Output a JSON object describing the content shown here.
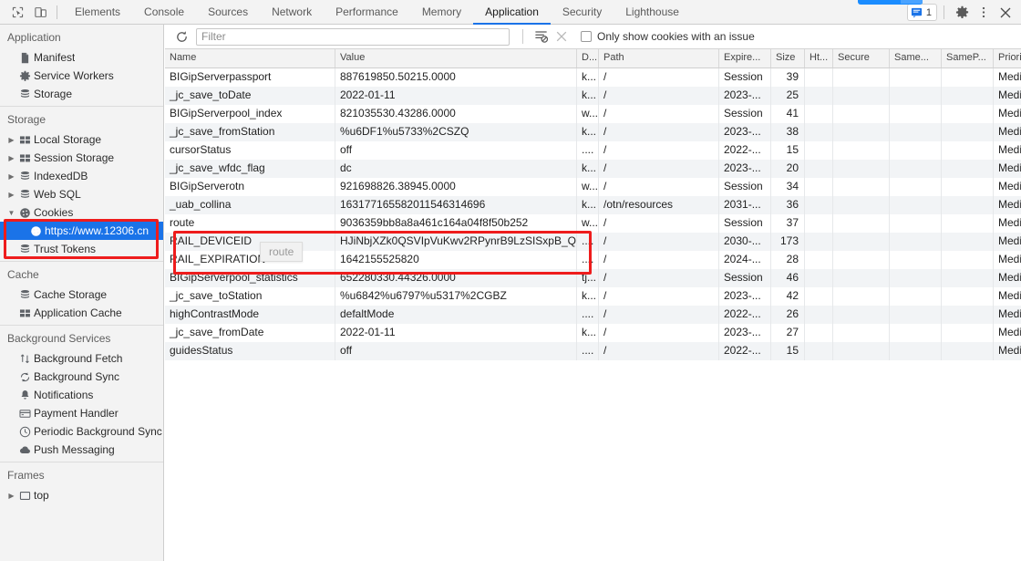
{
  "toolbar": {
    "inspect_icon": "inspect-element-icon",
    "device_icon": "device-toolbar-icon",
    "tabs": [
      {
        "label": "Elements",
        "active": false
      },
      {
        "label": "Console",
        "active": false
      },
      {
        "label": "Sources",
        "active": false
      },
      {
        "label": "Network",
        "active": false
      },
      {
        "label": "Performance",
        "active": false
      },
      {
        "label": "Memory",
        "active": false
      },
      {
        "label": "Application",
        "active": true
      },
      {
        "label": "Security",
        "active": false
      },
      {
        "label": "Lighthouse",
        "active": false
      }
    ],
    "message_count": "1",
    "settings_icon": "gear-icon",
    "more_icon": "more-vertical-icon",
    "close_icon": "close-icon"
  },
  "sidebar": {
    "sections": [
      {
        "title": "Application",
        "items": [
          {
            "label": "Manifest",
            "icon": "manifest-icon",
            "arrow": false,
            "sub": false,
            "selected": false
          },
          {
            "label": "Service Workers",
            "icon": "gear-icon",
            "arrow": false,
            "sub": false,
            "selected": false
          },
          {
            "label": "Storage",
            "icon": "database-icon",
            "arrow": false,
            "sub": false,
            "selected": false
          }
        ]
      },
      {
        "title": "Storage",
        "items": [
          {
            "label": "Local Storage",
            "icon": "table-icon",
            "arrow": true,
            "sub": false,
            "selected": false
          },
          {
            "label": "Session Storage",
            "icon": "table-icon",
            "arrow": true,
            "sub": false,
            "selected": false
          },
          {
            "label": "IndexedDB",
            "icon": "database-icon",
            "arrow": true,
            "sub": false,
            "selected": false
          },
          {
            "label": "Web SQL",
            "icon": "database-icon",
            "arrow": true,
            "sub": false,
            "selected": false
          },
          {
            "label": "Cookies",
            "icon": "cookie-icon",
            "arrow": "expanded",
            "sub": false,
            "selected": false
          },
          {
            "label": "https://www.12306.cn",
            "icon": "cookie-icon",
            "arrow": false,
            "sub": true,
            "selected": true
          },
          {
            "label": "Trust Tokens",
            "icon": "database-icon",
            "arrow": false,
            "sub": false,
            "selected": false
          }
        ]
      },
      {
        "title": "Cache",
        "items": [
          {
            "label": "Cache Storage",
            "icon": "database-icon",
            "arrow": false,
            "sub": false,
            "selected": false
          },
          {
            "label": "Application Cache",
            "icon": "table-icon",
            "arrow": false,
            "sub": false,
            "selected": false
          }
        ]
      },
      {
        "title": "Background Services",
        "items": [
          {
            "label": "Background Fetch",
            "icon": "arrows-updown-icon",
            "arrow": false,
            "sub": false,
            "selected": false
          },
          {
            "label": "Background Sync",
            "icon": "sync-icon",
            "arrow": false,
            "sub": false,
            "selected": false
          },
          {
            "label": "Notifications",
            "icon": "bell-icon",
            "arrow": false,
            "sub": false,
            "selected": false
          },
          {
            "label": "Payment Handler",
            "icon": "credit-card-icon",
            "arrow": false,
            "sub": false,
            "selected": false
          },
          {
            "label": "Periodic Background Sync",
            "icon": "clock-icon",
            "arrow": false,
            "sub": false,
            "selected": false
          },
          {
            "label": "Push Messaging",
            "icon": "cloud-icon",
            "arrow": false,
            "sub": false,
            "selected": false
          }
        ]
      },
      {
        "title": "Frames",
        "items": [
          {
            "label": "top",
            "icon": "frame-icon",
            "arrow": true,
            "sub": false,
            "selected": false
          }
        ]
      }
    ]
  },
  "filterbar": {
    "refresh_icon": "refresh-icon",
    "filter_placeholder": "Filter",
    "filter_value": "",
    "clear_filter_icon": "clear-filter-icon",
    "clear_icon": "close-icon",
    "issue_checkbox_label": "Only show cookies with an issue",
    "issue_checkbox_checked": false
  },
  "table": {
    "columns": [
      "Name",
      "Value",
      "D...",
      "Path",
      "Expire...",
      "Size",
      "Ht...",
      "Secure",
      "Same...",
      "SameP...",
      "Priority"
    ],
    "rows": [
      {
        "name": "BIGipServerpassport",
        "value": "887619850.50215.0000",
        "domain": "k...",
        "path": "/",
        "expires": "Session",
        "size": "39",
        "httponly": "",
        "secure": "",
        "samesite": "",
        "sameparty": "",
        "priority": "Medium"
      },
      {
        "name": "_jc_save_toDate",
        "value": "2022-01-11",
        "domain": "k...",
        "path": "/",
        "expires": "2023-...",
        "size": "25",
        "httponly": "",
        "secure": "",
        "samesite": "",
        "sameparty": "",
        "priority": "Medium"
      },
      {
        "name": "BIGipServerpool_index",
        "value": "821035530.43286.0000",
        "domain": "w...",
        "path": "/",
        "expires": "Session",
        "size": "41",
        "httponly": "",
        "secure": "",
        "samesite": "",
        "sameparty": "",
        "priority": "Medium"
      },
      {
        "name": "_jc_save_fromStation",
        "value": "%u6DF1%u5733%2CSZQ",
        "domain": "k...",
        "path": "/",
        "expires": "2023-...",
        "size": "38",
        "httponly": "",
        "secure": "",
        "samesite": "",
        "sameparty": "",
        "priority": "Medium"
      },
      {
        "name": "cursorStatus",
        "value": "off",
        "domain": "....",
        "path": "/",
        "expires": "2022-...",
        "size": "15",
        "httponly": "",
        "secure": "",
        "samesite": "",
        "sameparty": "",
        "priority": "Medium"
      },
      {
        "name": "_jc_save_wfdc_flag",
        "value": "dc",
        "domain": "k...",
        "path": "/",
        "expires": "2023-...",
        "size": "20",
        "httponly": "",
        "secure": "",
        "samesite": "",
        "sameparty": "",
        "priority": "Medium"
      },
      {
        "name": "BIGipServerotn",
        "value": "921698826.38945.0000",
        "domain": "w...",
        "path": "/",
        "expires": "Session",
        "size": "34",
        "httponly": "",
        "secure": "",
        "samesite": "",
        "sameparty": "",
        "priority": "Medium"
      },
      {
        "name": "_uab_collina",
        "value": "163177165582011546314696",
        "domain": "k...",
        "path": "/otn/resources",
        "expires": "2031-...",
        "size": "36",
        "httponly": "",
        "secure": "",
        "samesite": "",
        "sameparty": "",
        "priority": "Medium"
      },
      {
        "name": "route",
        "value": "9036359bb8a8a461c164a04f8f50b252",
        "domain": "w...",
        "path": "/",
        "expires": "Session",
        "size": "37",
        "httponly": "",
        "secure": "",
        "samesite": "",
        "sameparty": "",
        "priority": "Medium"
      },
      {
        "name": "RAIL_DEVICEID",
        "value": "HJiNbjXZk0QSVIpVuKwv2RPynrB9LzSISxpB_Q...",
        "domain": "....",
        "path": "/",
        "expires": "2030-...",
        "size": "173",
        "httponly": "",
        "secure": "",
        "samesite": "",
        "sameparty": "",
        "priority": "Medium"
      },
      {
        "name": "RAIL_EXPIRATION",
        "value": "1642155525820",
        "domain": "....",
        "path": "/",
        "expires": "2024-...",
        "size": "28",
        "httponly": "",
        "secure": "",
        "samesite": "",
        "sameparty": "",
        "priority": "Medium"
      },
      {
        "name": "BIGipServerpool_statistics",
        "value": "652280330.44326.0000",
        "domain": "tj...",
        "path": "/",
        "expires": "Session",
        "size": "46",
        "httponly": "",
        "secure": "",
        "samesite": "",
        "sameparty": "",
        "priority": "Medium"
      },
      {
        "name": "_jc_save_toStation",
        "value": "%u6842%u6797%u5317%2CGBZ",
        "domain": "k...",
        "path": "/",
        "expires": "2023-...",
        "size": "42",
        "httponly": "",
        "secure": "",
        "samesite": "",
        "sameparty": "",
        "priority": "Medium"
      },
      {
        "name": "highContrastMode",
        "value": "defaltMode",
        "domain": "....",
        "path": "/",
        "expires": "2022-...",
        "size": "26",
        "httponly": "",
        "secure": "",
        "samesite": "",
        "sameparty": "",
        "priority": "Medium"
      },
      {
        "name": "_jc_save_fromDate",
        "value": "2022-01-11",
        "domain": "k...",
        "path": "/",
        "expires": "2023-...",
        "size": "27",
        "httponly": "",
        "secure": "",
        "samesite": "",
        "sameparty": "",
        "priority": "Medium"
      },
      {
        "name": "guidesStatus",
        "value": "off",
        "domain": "....",
        "path": "/",
        "expires": "2022-...",
        "size": "15",
        "httponly": "",
        "secure": "",
        "samesite": "",
        "sameparty": "",
        "priority": "Medium"
      }
    ]
  },
  "tooltip": {
    "text": "route"
  },
  "annotations": {
    "highlight_color": "#ee1c1c"
  }
}
